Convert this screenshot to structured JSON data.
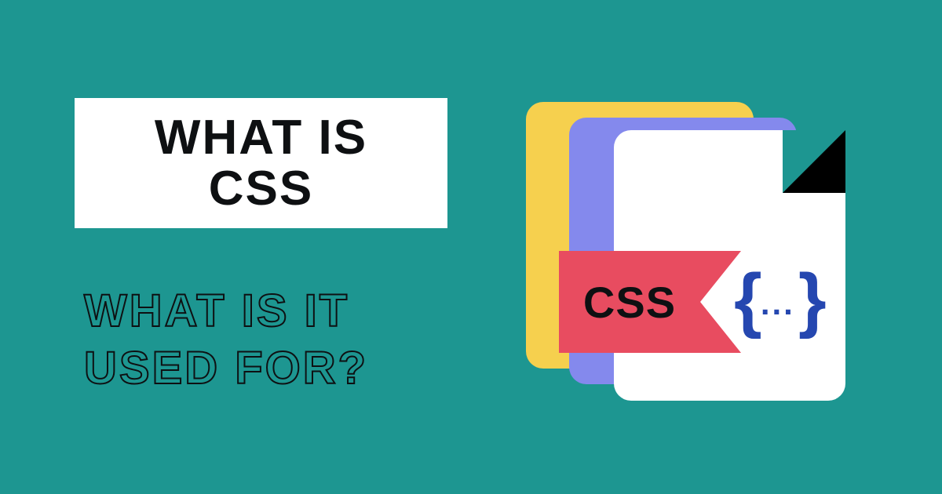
{
  "title": {
    "line1": "WHAT IS",
    "line2": "CSS"
  },
  "subtitle": {
    "line1": "WHAT IS IT",
    "line2": "USED FOR?"
  },
  "graphic": {
    "ribbon_text": "CSS",
    "braces_open": "{",
    "braces_dots": "...",
    "braces_close": "}"
  },
  "colors": {
    "background": "#1d9691",
    "file_yellow": "#f6d04e",
    "file_purple": "#8489ed",
    "file_white": "#ffffff",
    "ribbon": "#e84c60",
    "braces": "#2547b0"
  }
}
